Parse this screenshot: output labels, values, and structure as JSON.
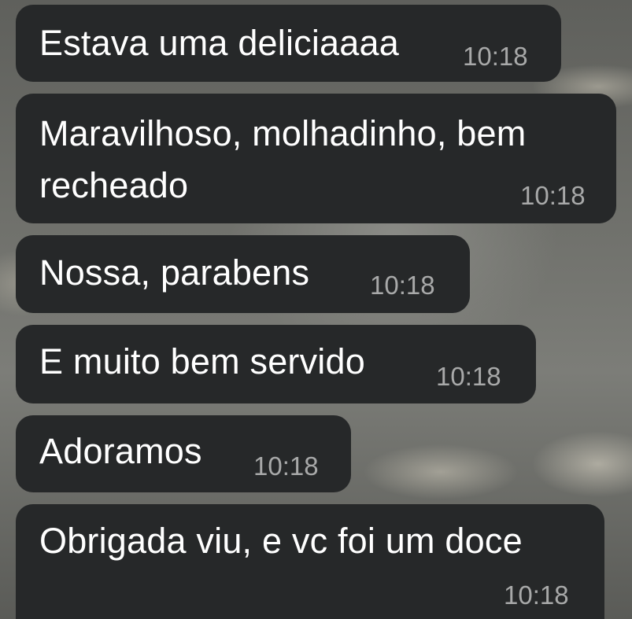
{
  "conversation": {
    "messages": [
      {
        "text": "Estava uma deliciaaaa",
        "time": "10:18"
      },
      {
        "text": "Maravilhoso, molhadinho, bem\nrecheado",
        "time": "10:18"
      },
      {
        "text": "Nossa, parabens",
        "time": "10:18"
      },
      {
        "text": "E muito bem servido",
        "time": "10:18"
      },
      {
        "text": "Adoramos",
        "time": "10:18"
      },
      {
        "text": "Obrigada viu, e vc foi um doce",
        "time": "10:18"
      }
    ]
  },
  "colors": {
    "bubble_background": "#262829",
    "message_text": "#ffffff",
    "timestamp_text": "#a8a9a9"
  }
}
